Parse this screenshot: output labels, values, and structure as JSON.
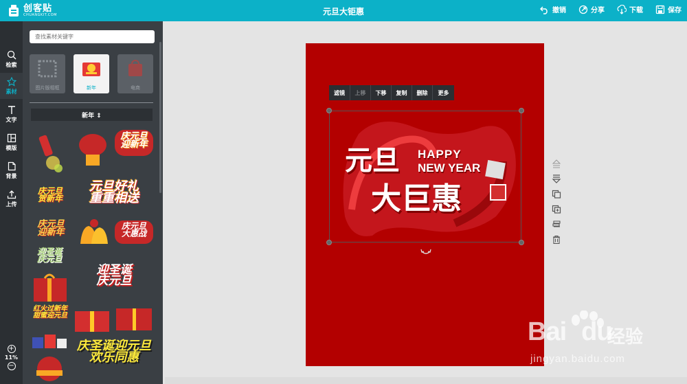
{
  "app": {
    "logo_name": "创客贴",
    "logo_sub": "CHUANGKIT.COM",
    "document_title": "元旦大钜惠"
  },
  "top_actions": [
    {
      "label": "撤销",
      "icon": "undo-icon"
    },
    {
      "label": "分享",
      "icon": "share-icon"
    },
    {
      "label": "下载",
      "icon": "download-icon"
    },
    {
      "label": "保存",
      "icon": "save-icon"
    }
  ],
  "rail": {
    "items": [
      {
        "label": "检索",
        "icon": "search-icon"
      },
      {
        "label": "素材",
        "icon": "star-icon",
        "active": true
      },
      {
        "label": "文字",
        "icon": "text-icon"
      },
      {
        "label": "模版",
        "icon": "template-icon"
      },
      {
        "label": "背景",
        "icon": "background-icon"
      },
      {
        "label": "上传",
        "icon": "upload-icon"
      }
    ],
    "zoom": "11%",
    "zoom_in": "+",
    "zoom_out": "−"
  },
  "panel": {
    "search_placeholder": "查找素材关键字",
    "categories": [
      {
        "label": "图片版相框"
      },
      {
        "label": "新年",
        "active": true
      },
      {
        "label": "电商"
      }
    ],
    "dropdown_label": "新年 ⇕",
    "stickers": {
      "s3": "庆元旦\n迎新年",
      "s5": "元旦好礼\n重重相送",
      "s6": "庆元旦\n贺新年",
      "s7": "庆元旦\n迎新年",
      "s9": "庆元旦\n大惠战",
      "s10": "迎圣诞\n庆元旦",
      "s12": "迎圣诞\n庆元旦",
      "s13": "红火过新年\n甜蜜迎元旦",
      "s17": "庆圣诞迎元旦\n欢乐同惠"
    }
  },
  "canvas": {
    "context_toolbar": [
      {
        "label": "滤镜",
        "disabled": false
      },
      {
        "label": "上移",
        "disabled": true
      },
      {
        "label": "下移",
        "disabled": false
      },
      {
        "label": "复制",
        "disabled": false
      },
      {
        "label": "删除",
        "disabled": false
      },
      {
        "label": "更多",
        "disabled": false
      }
    ],
    "hero": {
      "line1_left": "元旦",
      "happy": "HAPPY",
      "new_year": "NEW YEAR",
      "line2": "大巨惠"
    },
    "page_color": "#b30000"
  },
  "watermark": {
    "brand": "Bai",
    "brand2": "du",
    "cn": "经验",
    "url": "jingyan.baidu.com"
  },
  "colors": {
    "accent": "#0cb1c8",
    "rail_bg": "#2b2f33",
    "panel_bg": "#3a3f44"
  }
}
